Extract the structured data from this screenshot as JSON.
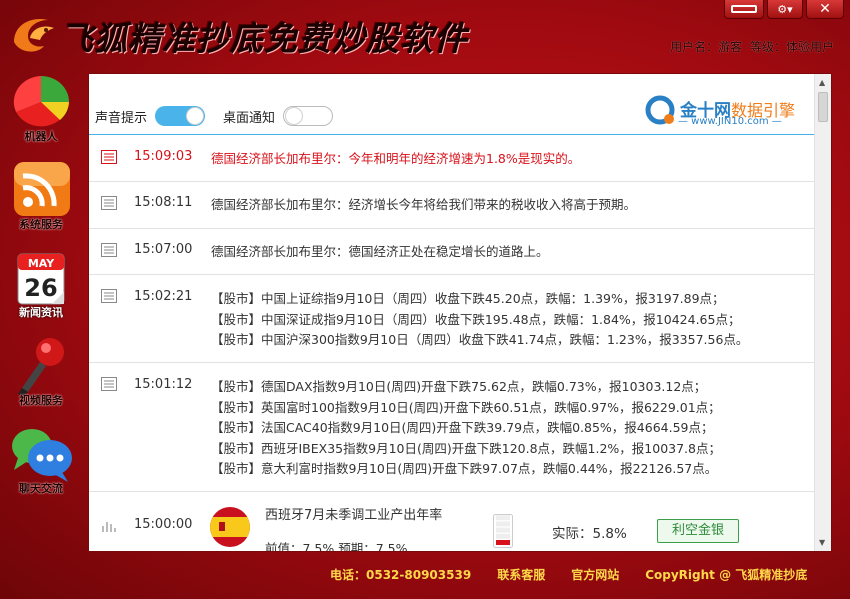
{
  "app": {
    "title": "飞狐精准抄底免费炒股软件",
    "user_label": "用户名：",
    "user_name": "游客",
    "level_label": "等级：",
    "level_value": "体验用户"
  },
  "window_controls": [
    "minimize",
    "menu",
    "close"
  ],
  "sidebar": {
    "items": [
      {
        "label": "机器人",
        "icon": "pie-chart-icon"
      },
      {
        "label": "系统服务",
        "icon": "rss-feed-icon"
      },
      {
        "label": "新闻资讯",
        "icon": "calendar-icon",
        "calendar_month": "MAY",
        "calendar_day": "26"
      },
      {
        "label": "视频服务",
        "icon": "microphone-icon"
      },
      {
        "label": "聊天交流",
        "icon": "chat-bubbles-icon"
      }
    ]
  },
  "panel": {
    "sound_label": "声音提示",
    "sound_on": true,
    "desktop_label": "桌面通知",
    "desktop_on": false,
    "brand_name": "金十网",
    "brand_sub": "数据引擎",
    "brand_url": "— www.JIN10.com —"
  },
  "news": [
    {
      "time": "15:09:03",
      "alert": true,
      "lines": [
        "德国经济部长加布里尔：今年和明年的经济增速为1.8%是现实的。"
      ]
    },
    {
      "time": "15:08:11",
      "alert": false,
      "lines": [
        "德国经济部长加布里尔：经济增长今年将给我们带来的税收收入将高于预期。"
      ]
    },
    {
      "time": "15:07:00",
      "alert": false,
      "lines": [
        "德国经济部长加布里尔：德国经济正处在稳定增长的道路上。"
      ]
    },
    {
      "time": "15:02:21",
      "alert": false,
      "lines": [
        "【股市】中国上证综指9月10日（周四）收盘下跌45.20点，跌幅：1.39%，报3197.89点；",
        "【股市】中国深证成指9月10日（周四）收盘下跌195.48点，跌幅：1.84%，报10424.65点；",
        "【股市】中国沪深300指数9月10日（周四）收盘下跌41.74点，跌幅：1.23%，报3357.56点。"
      ]
    },
    {
      "time": "15:01:12",
      "alert": false,
      "lines": [
        "【股市】德国DAX指数9月10日(周四)开盘下跌75.62点，跌幅0.73%，报10303.12点；",
        "【股市】英国富时100指数9月10日(周四)开盘下跌60.51点，跌幅0.97%，报6229.01点；",
        "【股市】法国CAC40指数9月10日(周四)开盘下跌39.79点，跌幅0.85%，报4664.59点；",
        "【股市】西班牙IBEX35指数9月10日(周四)开盘下跌120.8点，跌幅1.2%，报10037.8点；",
        "【股市】意大利富时指数9月10日(周四)开盘下跌97.07点，跌幅0.44%，报22126.57点。"
      ]
    }
  ],
  "data_item": {
    "time": "15:00:00",
    "country_flag": "spain-flag-icon",
    "title": "西班牙7月未季调工业产出年率",
    "prev": "前值：7.5%  预期：7.5%",
    "importance_level": 1,
    "importance_max": 5,
    "actual": "实际：5.8%",
    "impact": "利空金银"
  },
  "footer": {
    "phone": "电话：0532-80903539",
    "service": "联系客服",
    "website": "官方网站",
    "copyright": "CopyRight @ 飞狐精准抄底"
  },
  "colors": {
    "background": "#b40f15",
    "alert_text": "#d8121a",
    "accent_blue": "#4ab3ea",
    "footer_text": "#ffd84a",
    "impact_green": "#2e8b3a"
  }
}
